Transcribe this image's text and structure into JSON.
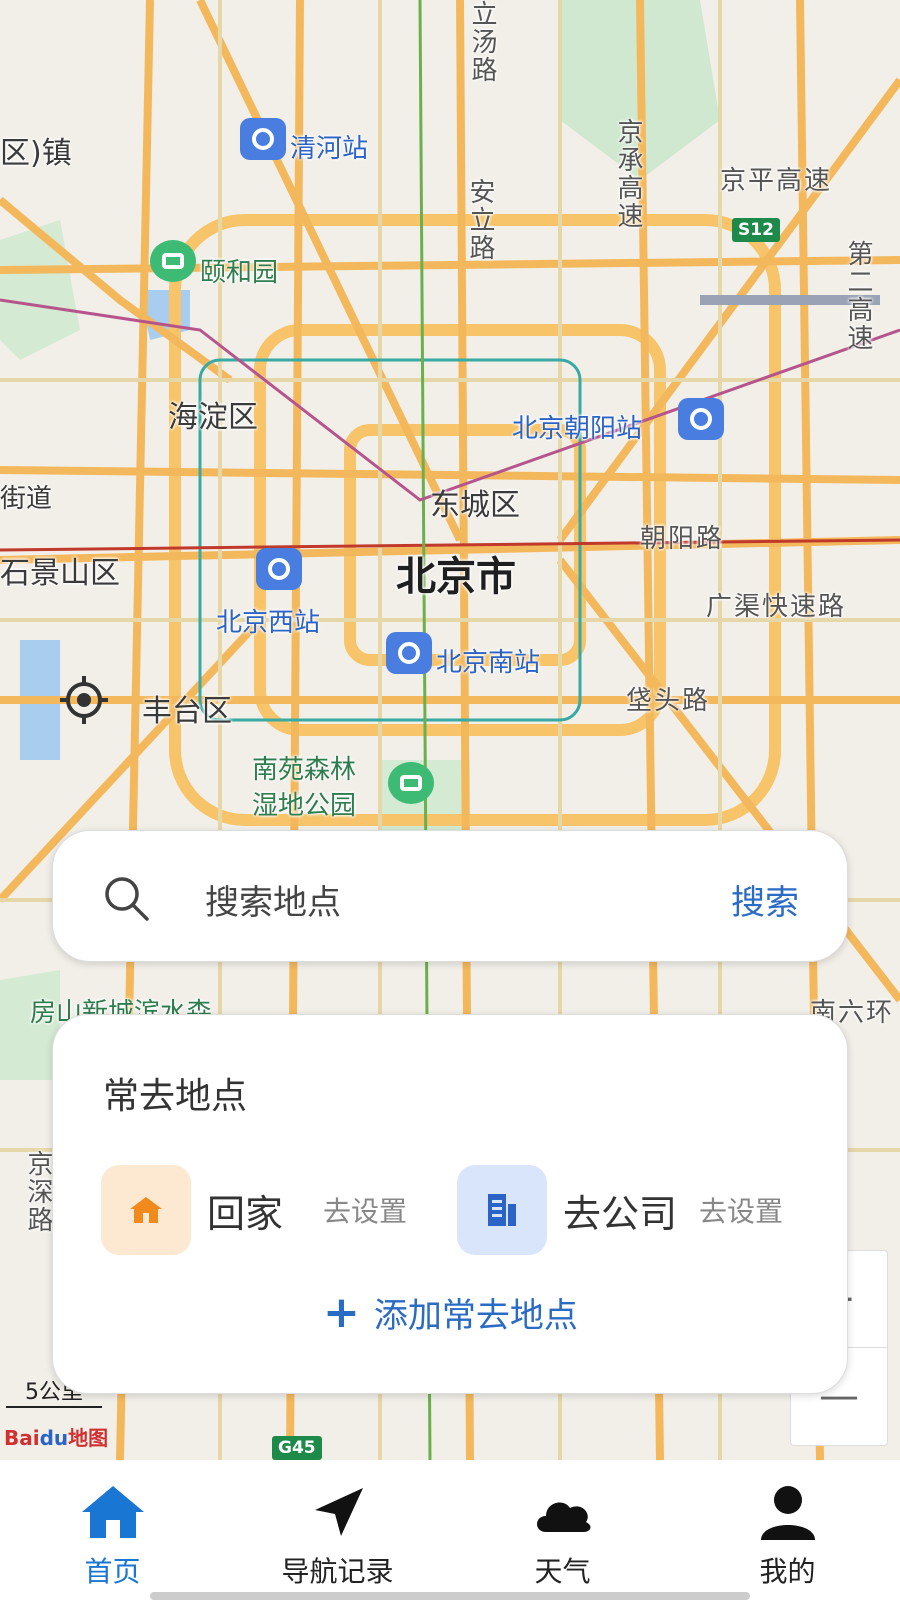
{
  "map": {
    "labels": {
      "qinghe_station": "清河站",
      "yiheyuan": "颐和园",
      "haidian": "海淀区",
      "dongcheng": "东城区",
      "beijing_city": "北京市",
      "shijingshan": "石景山区",
      "fengtai": "丰台区",
      "beijing_west": "北京西站",
      "beijing_south": "北京南站",
      "beijing_chaoyang": "北京朝阳站",
      "chaoyang_road": "朝阳路",
      "guangqu_expressway": "广渠快速路",
      "ditou_road": "垡头路",
      "jingping_expressway": "京平高速",
      "jingcheng_expressway": "京承高速",
      "lishuiqiao": "立汤路",
      "anli_road": "安立路",
      "second_ring": "第二高速",
      "nanyuan_park": "南苑森林湿地公园",
      "nanyuan_park_line1": "南苑森林",
      "nanyuan_park_line2": "湿地公园",
      "fangshan": "房山新城滨水森",
      "jieidao": "街道",
      "town": "区)镇",
      "jingshen": "京深路",
      "nanliu": "南六环",
      "s12": "S12",
      "g45": "G45"
    },
    "scale": "5公里",
    "logo_text": "Bai",
    "logo_du": "du",
    "logo_map": "地图",
    "zoom_in": "+",
    "zoom_out": "—"
  },
  "search": {
    "placeholder": "搜索地点",
    "button": "搜索",
    "icon": "search-icon"
  },
  "frequent": {
    "title": "常去地点",
    "home": {
      "name": "回家",
      "action": "去设置",
      "icon": "home-icon",
      "bg": "#fde8d2",
      "fg": "#f08a1c"
    },
    "work": {
      "name": "去公司",
      "action": "去设置",
      "icon": "building-icon",
      "bg": "#d9e5fb",
      "fg": "#2b63c6"
    },
    "add": "添加常去地点"
  },
  "tabbar": {
    "tabs": [
      {
        "label": "首页",
        "icon": "home-icon",
        "active": true
      },
      {
        "label": "导航记录",
        "icon": "navigation-arrow-icon",
        "active": false
      },
      {
        "label": "天气",
        "icon": "cloud-icon",
        "active": false
      },
      {
        "label": "我的",
        "icon": "user-icon",
        "active": false
      }
    ]
  },
  "colors": {
    "accent": "#1976d2",
    "link": "#2a6bc4"
  }
}
